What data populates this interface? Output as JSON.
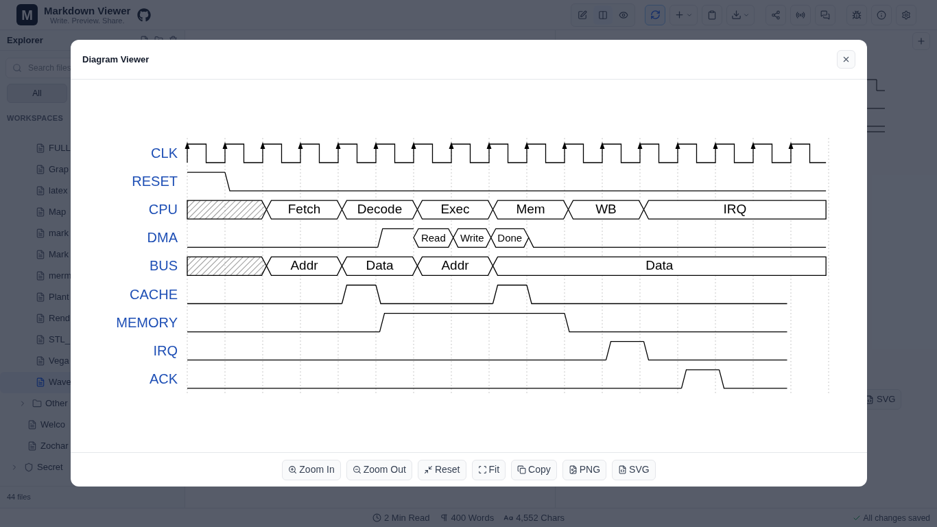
{
  "app": {
    "logo": "M",
    "title": "Markdown Viewer",
    "subtitle": "Write. Preview. Share."
  },
  "sidebar": {
    "title": "Explorer",
    "search": {
      "placeholder": "Search files"
    },
    "filter": {
      "label": "All",
      "selected": true
    },
    "section": "WORKSPACES",
    "tree": [
      {
        "children": [
          {
            "children": [
              {
                "kind": "file",
                "name": "FULL",
                "selected": false
              },
              {
                "kind": "file",
                "name": "Grap",
                "selected": false
              },
              {
                "kind": "file",
                "name": "latex",
                "selected": false
              },
              {
                "kind": "file",
                "name": "Map",
                "selected": false
              },
              {
                "kind": "file",
                "name": "mark",
                "selected": false
              },
              {
                "kind": "file",
                "name": "Mark",
                "selected": false
              },
              {
                "kind": "file",
                "name": "merm",
                "selected": false
              },
              {
                "kind": "file",
                "name": "Plant",
                "selected": false
              },
              {
                "kind": "file",
                "name": "Rend",
                "selected": false
              },
              {
                "kind": "file",
                "name": "STL_",
                "selected": false
              },
              {
                "kind": "file",
                "name": "Vega",
                "selected": false
              },
              {
                "kind": "file",
                "name": "Wave",
                "selected": true
              }
            ]
          },
          {
            "kind": "folder",
            "name": "Other",
            "expanded": false
          },
          {
            "kind": "file",
            "name": "Welco",
            "selected": false
          },
          {
            "kind": "file",
            "name": "Zochar",
            "selected": false
          }
        ]
      },
      {
        "kind": "workspace",
        "name": "Secret",
        "expanded": false
      }
    ],
    "footer": "44 files"
  },
  "preview": {
    "button": "SVG"
  },
  "status_bar": {
    "read_time": "2 Min Read",
    "words": "400 Words",
    "chars": "4,552 Chars",
    "saved": "All changes saved"
  },
  "dialog": {
    "title": "Diagram Viewer",
    "signals": [
      {
        "name": "CLK",
        "kind": "clock"
      },
      {
        "name": "RESET",
        "kind": "wave",
        "segments": [
          {
            "kind": "high"
          },
          {
            "kind": "low"
          }
        ]
      },
      {
        "name": "CPU",
        "kind": "wave",
        "segments": [
          {
            "kind": "hatched"
          },
          {
            "kind": "data",
            "label": "Fetch"
          },
          {
            "kind": "data",
            "label": "Decode"
          },
          {
            "kind": "data",
            "label": "Exec"
          },
          {
            "kind": "data",
            "label": "Mem"
          },
          {
            "kind": "data",
            "label": "WB"
          },
          {
            "kind": "data",
            "label": "IRQ"
          }
        ]
      },
      {
        "name": "DMA",
        "kind": "wave",
        "segments": [
          {
            "kind": "low"
          },
          {
            "kind": "high"
          },
          {
            "kind": "data",
            "label": "Read"
          },
          {
            "kind": "data",
            "label": "Write"
          },
          {
            "kind": "data",
            "label": "Done"
          },
          {
            "kind": "low"
          }
        ]
      },
      {
        "name": "BUS",
        "kind": "wave",
        "segments": [
          {
            "kind": "hatched"
          },
          {
            "kind": "data",
            "label": "Addr"
          },
          {
            "kind": "data",
            "label": "Data"
          },
          {
            "kind": "data",
            "label": "Addr"
          },
          {
            "kind": "data",
            "label": "Data"
          }
        ]
      },
      {
        "name": "CACHE",
        "kind": "wave",
        "segments": [
          {
            "kind": "low"
          },
          {
            "kind": "high"
          },
          {
            "kind": "low"
          },
          {
            "kind": "high"
          },
          {
            "kind": "low"
          }
        ]
      },
      {
        "name": "MEMORY",
        "kind": "wave",
        "segments": [
          {
            "kind": "low"
          },
          {
            "kind": "high"
          },
          {
            "kind": "low"
          }
        ]
      },
      {
        "name": "IRQ",
        "kind": "wave",
        "segments": [
          {
            "kind": "low"
          },
          {
            "kind": "high"
          },
          {
            "kind": "low"
          }
        ]
      },
      {
        "name": "ACK",
        "kind": "wave",
        "segments": [
          {
            "kind": "low"
          },
          {
            "kind": "high"
          },
          {
            "kind": "low"
          }
        ]
      }
    ],
    "buttons": [
      "Zoom In",
      "Zoom Out",
      "Reset",
      "Fit",
      "Copy",
      "PNG",
      "SVG"
    ]
  }
}
